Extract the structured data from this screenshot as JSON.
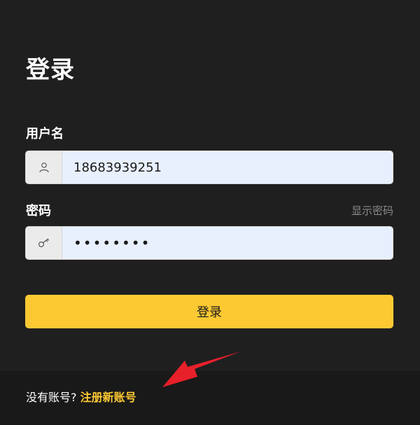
{
  "page": {
    "title": "登录"
  },
  "form": {
    "username_label": "用户名",
    "username_value": "18683939251",
    "password_label": "密码",
    "show_password": "显示密码",
    "password_value": "12345678",
    "submit_label": "登录"
  },
  "footer": {
    "prompt": "没有账号?",
    "register_link": "注册新账号"
  },
  "colors": {
    "accent": "#fdc933",
    "annotation_arrow": "#e8202a"
  },
  "icons": {
    "user": "user-icon",
    "password": "key-icon",
    "annotation": "red-arrow-annotation"
  }
}
